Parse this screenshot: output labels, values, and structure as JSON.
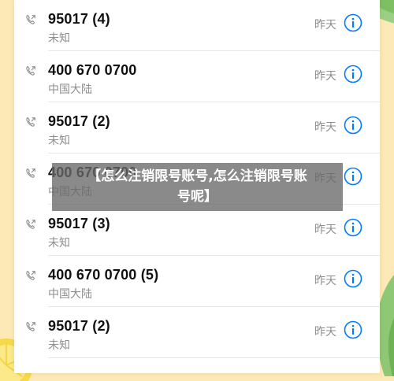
{
  "calls": [
    {
      "number": "95017 (4)",
      "subtitle": "未知",
      "time": "昨天"
    },
    {
      "number": "400 670 0700",
      "subtitle": "中国大陆",
      "time": "昨天"
    },
    {
      "number": "95017 (2)",
      "subtitle": "未知",
      "time": "昨天"
    },
    {
      "number": "400 670 0700",
      "subtitle": "中国大陆",
      "time": "昨天"
    },
    {
      "number": "95017 (3)",
      "subtitle": "未知",
      "time": "昨天"
    },
    {
      "number": "400 670 0700 (5)",
      "subtitle": "中国大陆",
      "time": "昨天"
    },
    {
      "number": "95017 (2)",
      "subtitle": "未知",
      "time": "昨天"
    }
  ],
  "banner": {
    "line1": "【怎么注销限号账号,怎么注销限号账",
    "line2": "号呢】"
  },
  "colors": {
    "accent": "#007aff",
    "muted": "#8e8e8e",
    "background": "#fde9b5"
  },
  "icons": {
    "call": "phone-outgoing-icon",
    "info": "info-icon"
  }
}
